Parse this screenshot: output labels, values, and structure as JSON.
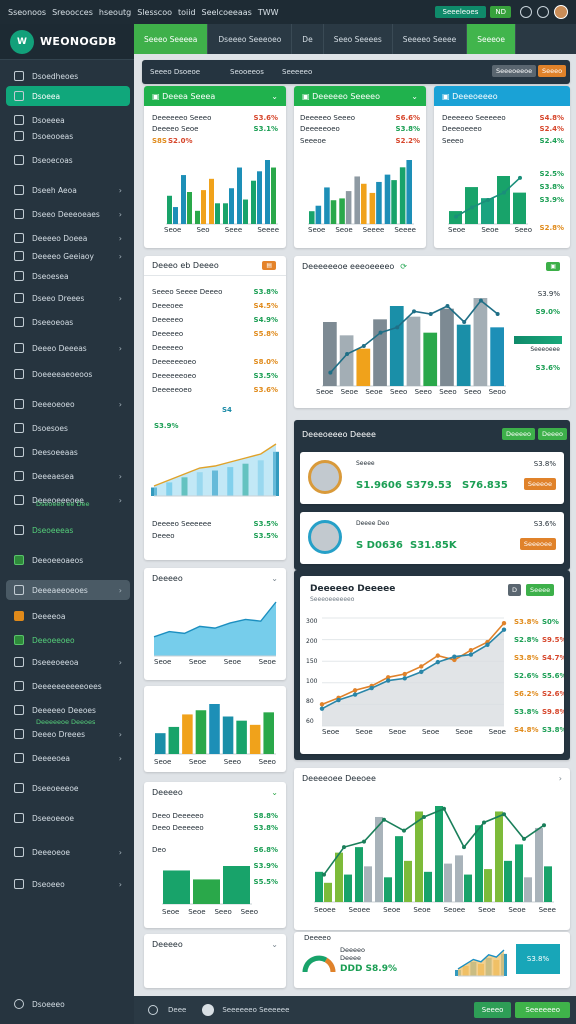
{
  "topbar": {
    "items": [
      "Sseonoos",
      "Sreoocces",
      "hseoutg",
      "Slesscoo",
      "toiid",
      "Seelcoeeaas",
      "TWW"
    ],
    "pill_label": "Seeeleoes",
    "pill_small": "ND"
  },
  "brand": {
    "name": "WEONOGDB",
    "logo": "W"
  },
  "sidebar": {
    "items": [
      {
        "label": "Dsoedheoes",
        "icon": "grid-icon"
      },
      {
        "label": "Dsoeea",
        "icon": "shield-icon"
      },
      {
        "label": "Dsoeeea",
        "icon": "bar-icon"
      },
      {
        "label": "Dsoeooeas",
        "icon": "chart-icon"
      },
      {
        "label": "Dseoecoas",
        "icon": "folder-icon"
      },
      {
        "label": "Dseeh Aeoa",
        "icon": "user-icon"
      },
      {
        "label": "Dseeo Deeeoeaes",
        "icon": "layers-icon"
      },
      {
        "label": "Deeeeo Doeea",
        "icon": "doc-icon"
      },
      {
        "label": "Deeeeo Geeiaoy",
        "icon": "globe-icon"
      },
      {
        "label": "Dseoesea",
        "icon": "tag-icon"
      },
      {
        "label": "Dseeo Dreees",
        "icon": "calendar-icon"
      },
      {
        "label": "Dseeoeoas",
        "icon": "chart-icon"
      },
      {
        "label": "Deeeo Deeeas",
        "icon": "mail-icon"
      },
      {
        "label": "Doeeeeaeoeoos",
        "icon": "pin-icon"
      },
      {
        "label": "Deeeoeoeo",
        "icon": "clock-icon"
      },
      {
        "label": "Dsoesoes",
        "icon": "settings-icon"
      },
      {
        "label": "Deesoeeaas",
        "icon": "link-icon"
      },
      {
        "label": "Deeeaesea",
        "icon": "user-icon"
      },
      {
        "label": "Deeeoeeeoee",
        "icon": "chat-icon"
      },
      {
        "label": "Dseoeeeas",
        "icon": "sync-icon"
      },
      {
        "label": "Deeoeeoaeos",
        "icon": "flag-icon"
      },
      {
        "label": "Deeeaeeoeoes",
        "icon": "star-icon"
      },
      {
        "label": "Deeeeoa",
        "icon": "lock-icon"
      },
      {
        "label": "Deeoeeoeo",
        "icon": "box-icon"
      },
      {
        "label": "Dseeeoeeoa",
        "icon": "cart-icon"
      },
      {
        "label": "Deeeeeeeeeeoees",
        "icon": "bolt-icon"
      },
      {
        "label": "Deeeeeo Deeoes",
        "icon": "globe-icon"
      },
      {
        "label": "Deeeo Dreees",
        "icon": "gift-icon"
      },
      {
        "label": "Deeeeoea",
        "icon": "bell-icon"
      },
      {
        "label": "Dseeoeeeoe",
        "icon": "eye-icon"
      },
      {
        "label": "Dseeoeeoe",
        "icon": "home-icon"
      },
      {
        "label": "Deeeoeoe",
        "icon": "book-icon"
      },
      {
        "label": "Dseoeeo",
        "icon": "help-icon"
      }
    ],
    "extra_labels": [
      "Dseoeeo ee Dee",
      "Deeeeeoe Deeoes"
    ],
    "footer_label": "Dsoeeeo"
  },
  "header2": {
    "tabs": [
      "Seeeo Seeeea",
      "Dseeeo Seeeoeo",
      "De",
      "Seeo Seeees",
      "Seeeeo Seeee",
      "Seeeoe"
    ]
  },
  "toolbar": {
    "tabs": [
      "Seeeo Dsoeoe",
      "Seooeeos",
      "Seeeeeo",
      "Seeeeeo"
    ],
    "btn": "Seeeoeeoe",
    "btn2": "Seeeo"
  },
  "card1": {
    "title": "Deeea Seeea",
    "rows": [
      {
        "l": "Deeeeeeo Seeeo",
        "v": "S3.6%"
      },
      {
        "l": "Deeeeo Seoe",
        "v": "S3.1%"
      },
      {
        "l": "S8S",
        "v": "S2.0%"
      }
    ],
    "labels": [
      "Seoe",
      "Seo",
      "Seee",
      "Seeee"
    ],
    "chart_data": {
      "type": "bar",
      "series": [
        {
          "name": "",
          "values": [
            30,
            52,
            14,
            48,
            22,
            60,
            46,
            68
          ]
        },
        {
          "name": "",
          "values": [
            18,
            34,
            36,
            22,
            38,
            26,
            56,
            60
          ]
        }
      ],
      "categories": [
        "1",
        "2",
        "3",
        "4",
        "5",
        "6",
        "7",
        "8"
      ]
    }
  },
  "card2": {
    "title": "Deeeeeo Seeeeo",
    "rows": [
      {
        "l": "Deeeeeo Seeeo",
        "v": "S6.6%"
      },
      {
        "l": "Deeeeeoeo",
        "v": "S3.8%"
      },
      {
        "l": "Seeeoe",
        "v": "S2.2%"
      }
    ],
    "labels": [
      "Seoe",
      "Seoe",
      "Seeee",
      "Seeee"
    ],
    "chart_data": {
      "type": "bar",
      "series": [
        {
          "name": "",
          "values": [
            14,
            40,
            28,
            52,
            34,
            54,
            62
          ]
        },
        {
          "name": "",
          "values": [
            20,
            26,
            36,
            44,
            46,
            48,
            70
          ]
        }
      ],
      "categories": [
        "1",
        "2",
        "3",
        "4",
        "5",
        "6",
        "7"
      ]
    }
  },
  "card3": {
    "title": "Deeeoeeeo",
    "rows": [
      {
        "l": "Deeeeeo Seeeeeo",
        "v": "S4.8%"
      },
      {
        "l": "Deeeoeeeo",
        "v": "S2.4%"
      },
      {
        "l": "Seeeo",
        "v": "S2.4%"
      }
    ],
    "side": [
      "S2.5%",
      "S3.8%",
      "S3.9%",
      "S2.8%"
    ],
    "labels": [
      "Seoe",
      "Seoe",
      "Seeo"
    ],
    "chart_data": {
      "type": "bar",
      "series": [
        {
          "name": "",
          "values": [
            14,
            40,
            28,
            52,
            34
          ]
        }
      ],
      "categories": [
        "1",
        "2",
        "3",
        "4",
        "5"
      ]
    }
  },
  "card4": {
    "title": "Deeeo eb Deeeo",
    "rows": [
      {
        "l": "Seeeo Seeee Deeeo",
        "v": "S3.8%"
      },
      {
        "l": "Deeeoee",
        "v": "S4.5%"
      },
      {
        "l": "Deeeeeo",
        "v": "S4.9%"
      },
      {
        "l": "Deeeeeo",
        "v": "S5.8%"
      },
      {
        "l": "Deeeeeo",
        "v": ""
      },
      {
        "l": "Deeeeeeoeo",
        "v": "S8.0%"
      },
      {
        "l": "Deeeeeeoeo",
        "v": "S3.5%"
      },
      {
        "l": "Deeeeeoeo",
        "v": "S3.6%"
      }
    ],
    "small": "S3.9%",
    "badge": "S4",
    "rows2": [
      {
        "l": "Deeeeo Seeeeee",
        "v": "S3.5%"
      },
      {
        "l": "Deeeo",
        "v": "S3.5%"
      }
    ],
    "chart_data": {
      "type": "area",
      "x": [
        1,
        2,
        3,
        4,
        5,
        6,
        7,
        8,
        9
      ],
      "values": [
        10,
        16,
        22,
        28,
        30,
        34,
        38,
        42,
        52
      ]
    }
  },
  "card5": {
    "title": "Deeeeeeoe eeeoeeeeo",
    "labels": [
      "Seoe",
      "Seoe",
      "Seoe",
      "Seeo",
      "Seeo",
      "Seeo",
      "Seeo",
      "Seoo"
    ],
    "side": [
      "S3.9%",
      "Seeeoeee",
      "S9.0%",
      "S3.6%"
    ],
    "chart_data": {
      "type": "bar",
      "series": [
        {
          "name": "",
          "values": [
            48,
            38,
            28,
            50,
            60,
            52,
            40,
            58,
            46,
            66,
            44
          ]
        }
      ],
      "categories": [
        "1",
        "2",
        "3",
        "4",
        "5",
        "6",
        "7",
        "8",
        "9",
        "10",
        "11"
      ]
    }
  },
  "card6": {
    "title": "Deeeoeeeo Deeee",
    "btn1": "Deeeeo",
    "btn2": "Deeeo",
    "people": [
      {
        "name": "Seeee",
        "v1": "S1.9606",
        "v2": "S379.53",
        "v3": "S76.835",
        "v4": "S3.8%",
        "btn": "Seeeoe"
      },
      {
        "name": "Deeee Deo",
        "v1": "S D0636",
        "v2": "S31.85K",
        "v3": "",
        "v4": "S3.6%",
        "btn": "Seeeoee"
      }
    ]
  },
  "card7": {
    "title": "Deeeeo",
    "labels": [
      "Seoe",
      "Seoe",
      "Seoe",
      "Seoe"
    ],
    "chart_data": {
      "type": "area",
      "x": [
        1,
        2,
        3,
        4,
        5,
        6,
        7,
        8,
        9
      ],
      "values": [
        22,
        28,
        26,
        34,
        32,
        38,
        42,
        40,
        62
      ]
    }
  },
  "card8": {
    "labels": [
      "Seoe",
      "Seoe",
      "Seeo",
      "Seeo"
    ],
    "chart_data": {
      "type": "bar",
      "series": [
        {
          "name": "",
          "values": [
            20,
            26,
            38,
            42,
            48,
            36,
            32,
            28,
            40
          ]
        }
      ],
      "categories": [
        "1",
        "2",
        "3",
        "4",
        "5",
        "6",
        "7",
        "8",
        "9"
      ]
    }
  },
  "card9": {
    "title": "Deeeeeo Deeeee",
    "subtitle": "Seeeoeeeeeeo",
    "btn1": "D",
    "btn2": "Seeee",
    "yticks": [
      "300",
      "200",
      "150",
      "100",
      "80",
      "60"
    ],
    "xlabels": [
      "Seoe",
      "Seoe",
      "Seoe",
      "Seoe",
      "Seoe",
      "Seoe",
      "Seoe",
      "Seoe"
    ],
    "side": [
      {
        "l": "S3.8%",
        "v": "S0%"
      },
      {
        "l": "S2.8%",
        "v": "S9.5%"
      },
      {
        "l": "S3.8%",
        "v": "S4.7%"
      },
      {
        "l": "S2.6%",
        "v": "S5.6%"
      },
      {
        "l": "S6.2%",
        "v": "S2.6%"
      },
      {
        "l": "S3.8%",
        "v": "S9.8%"
      },
      {
        "l": "S4.8%",
        "v": "S3.8%"
      }
    ],
    "chart_data": {
      "type": "line",
      "x": [
        1,
        2,
        3,
        4,
        5,
        6,
        7,
        8,
        9,
        10,
        11,
        12
      ],
      "series": [
        {
          "name": "",
          "values": [
            40,
            52,
            66,
            74,
            90,
            96,
            110,
            130,
            122,
            140,
            155,
            190
          ]
        },
        {
          "name": "",
          "values": [
            32,
            48,
            58,
            70,
            84,
            88,
            100,
            118,
            128,
            132,
            150,
            178
          ]
        }
      ]
    }
  },
  "card10": {
    "title": "Deeeeo",
    "rows": [
      {
        "l": "Deeo Deeeeeo",
        "v": "S8.8%"
      },
      {
        "l": "Deeo Deeeeeo",
        "v": "S3.8%"
      },
      {
        "l": "Deo",
        "v": "S6.8%"
      }
    ],
    "side": [
      "S3.9%",
      "S5.5%"
    ],
    "labels": [
      "Seoe",
      "Seoe",
      "Seeo",
      "Seeo"
    ],
    "chart_data": {
      "type": "bar",
      "series": [
        {
          "name": "",
          "values": [
            30,
            22,
            34
          ]
        }
      ],
      "categories": [
        "1",
        "2",
        "3"
      ]
    }
  },
  "card11": {
    "title": "Deeeeoee Deeoee",
    "labels": [
      "Seoee",
      "Seoee",
      "Seoe",
      "Seoe",
      "Seoee",
      "Seoe",
      "Seoe",
      "Seee"
    ],
    "chart_data": {
      "type": "bar",
      "series": [
        {
          "name": "",
          "values": [
            22,
            36,
            40,
            62,
            48,
            66,
            70,
            34,
            56,
            66,
            42,
            54
          ]
        },
        {
          "name": "",
          "values": [
            14,
            20,
            26,
            18,
            30,
            22,
            28,
            20,
            24,
            30,
            18,
            26
          ]
        }
      ],
      "categories": [
        "1",
        "2",
        "3",
        "4",
        "5",
        "6",
        "7",
        "8",
        "9",
        "10",
        "11",
        "12"
      ]
    }
  },
  "card12": {
    "title": "Deeeeo",
    "gauge_labels": [
      "Deeeeo",
      "Deeee"
    ],
    "gauge_value": "DDD S8.9%",
    "small_value": "S3.8%",
    "chart_data": {
      "type": "area",
      "x": [
        1,
        2,
        3,
        4,
        5,
        6,
        7
      ],
      "values": [
        6,
        10,
        14,
        12,
        18,
        16,
        22
      ]
    }
  },
  "card13": {
    "title": "Deeeeo"
  },
  "footer": {
    "items": [
      "Deee",
      "Seeeeeeo Seeeeee"
    ],
    "btn": "Seeeo",
    "btn2": "Seeeeeeo"
  }
}
